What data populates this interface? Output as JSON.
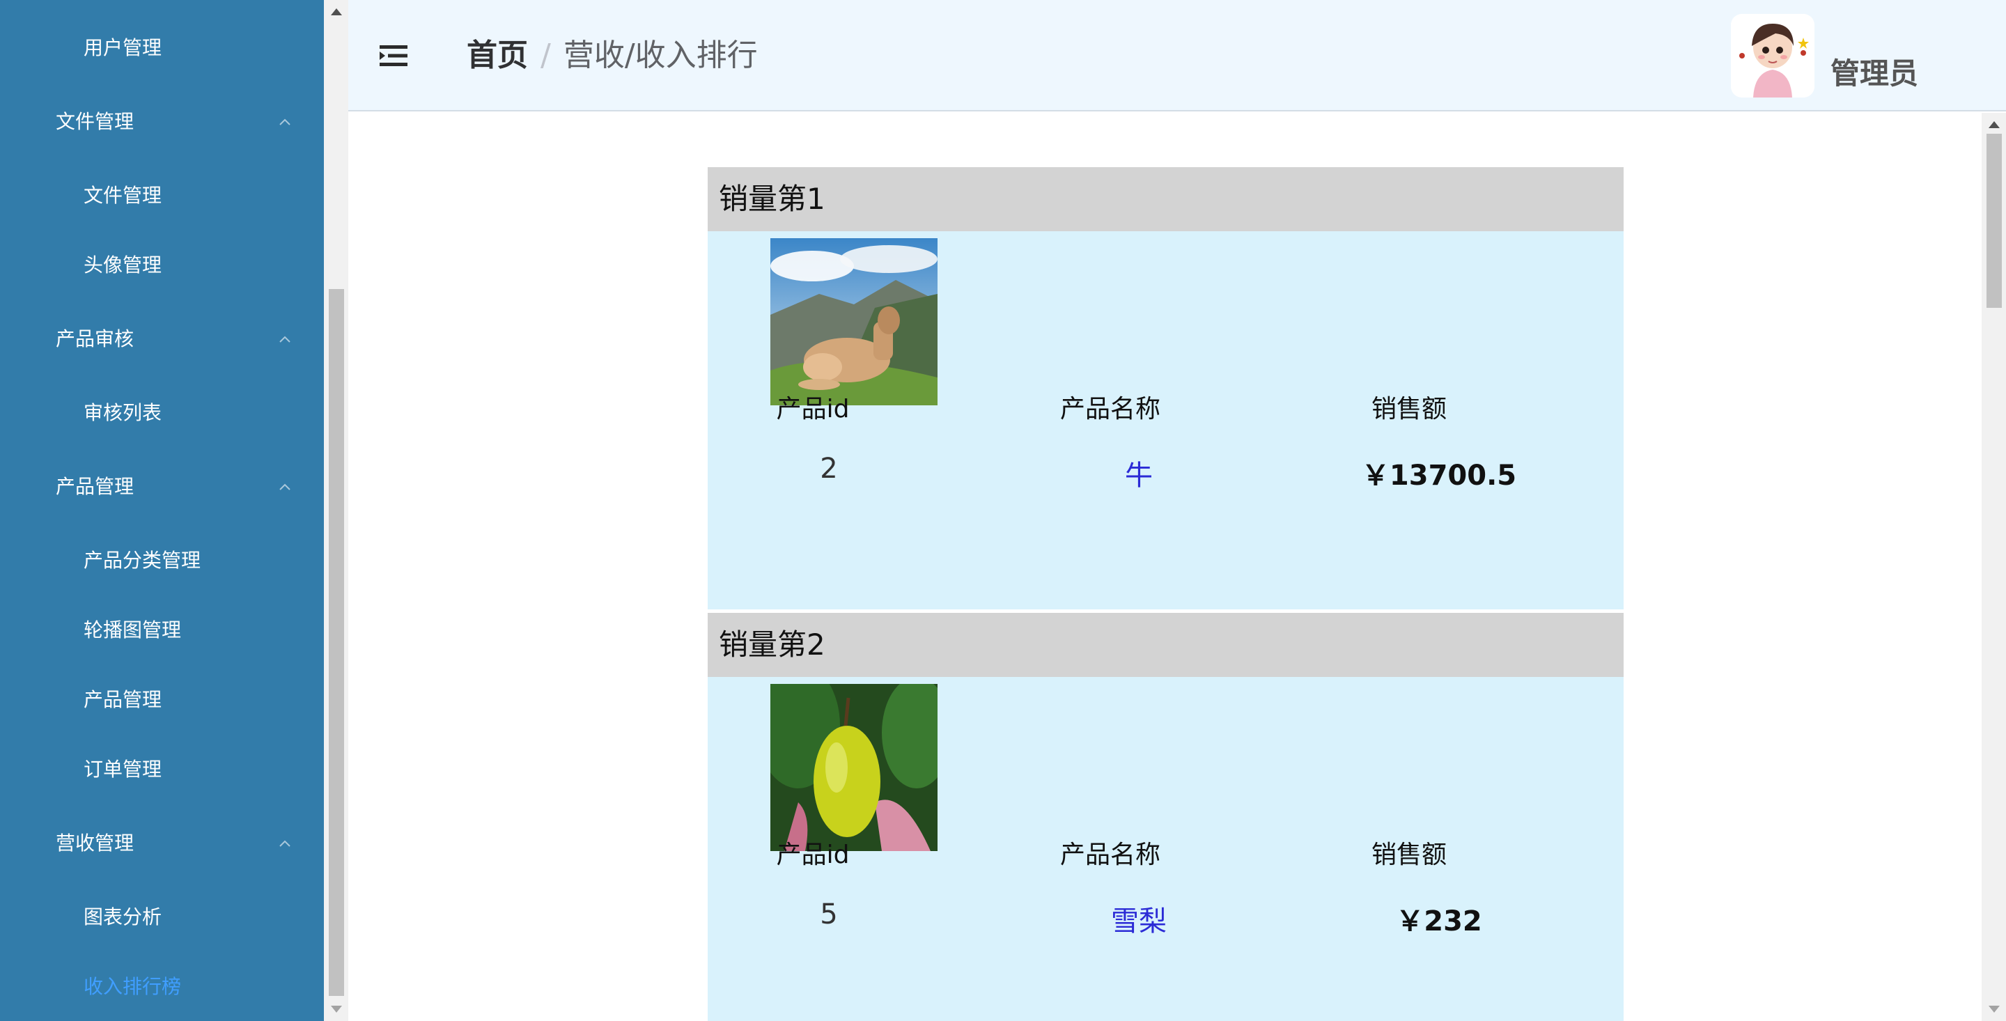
{
  "sidebar": {
    "items": [
      {
        "label": "用户管理",
        "type": "child",
        "active": false
      },
      {
        "label": "文件管理",
        "type": "group"
      },
      {
        "label": "文件管理",
        "type": "child",
        "active": false
      },
      {
        "label": "头像管理",
        "type": "child",
        "active": false
      },
      {
        "label": "产品审核",
        "type": "group"
      },
      {
        "label": "审核列表",
        "type": "child",
        "active": false
      },
      {
        "label": "产品管理",
        "type": "group"
      },
      {
        "label": "产品分类管理",
        "type": "child",
        "active": false
      },
      {
        "label": "轮播图管理",
        "type": "child",
        "active": false
      },
      {
        "label": "产品管理",
        "type": "child",
        "active": false
      },
      {
        "label": "订单管理",
        "type": "child",
        "active": false
      },
      {
        "label": "营收管理",
        "type": "group"
      },
      {
        "label": "图表分析",
        "type": "child",
        "active": false
      },
      {
        "label": "收入排行榜",
        "type": "child",
        "active": true
      }
    ],
    "colors": {
      "background": "#327CAA",
      "active_text": "#409EFF"
    }
  },
  "header": {
    "menu_icon": "menu-fold-icon",
    "breadcrumb": {
      "home": "首页",
      "separator": "/",
      "current": "营收/收入排行"
    },
    "user": {
      "name": "管理员",
      "avatar_icon": "cartoon-avatar"
    }
  },
  "ranking": [
    {
      "title": "销量第1",
      "image": "cow-on-hillside",
      "headers": {
        "id": "产品id",
        "name": "产品名称",
        "sales": "销售额"
      },
      "values": {
        "id": "2",
        "name": "牛",
        "sales": "￥13700.5"
      }
    },
    {
      "title": "销量第2",
      "image": "pear-on-branch",
      "headers": {
        "id": "产品id",
        "name": "产品名称",
        "sales": "销售额"
      },
      "values": {
        "id": "5",
        "name": "雪梨",
        "sales": "￥232"
      }
    }
  ]
}
